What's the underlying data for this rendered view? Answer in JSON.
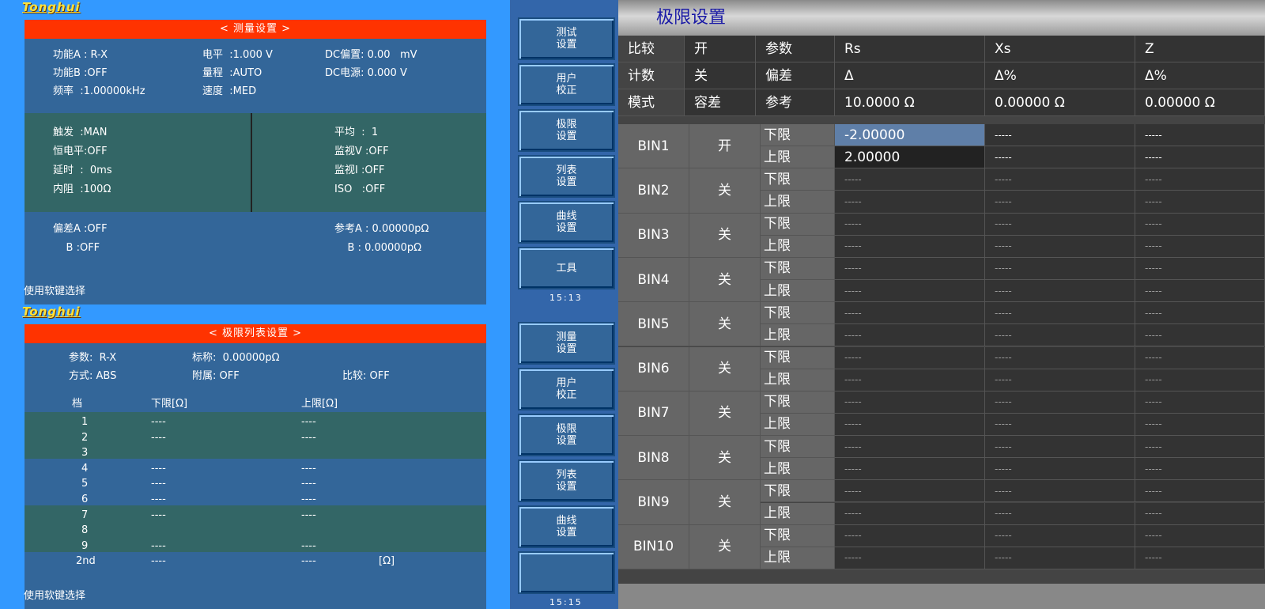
{
  "top": {
    "logo": "Tonghui",
    "title": "< 测量设置 >",
    "hint": "使用软键选择",
    "time": "15:13",
    "rows": [
      [
        "功能A : R-X",
        "电平  :1.000 V",
        "DC偏置: 0.00   mV"
      ],
      [
        "功能B :OFF",
        "量程  :AUTO",
        "DC电源: 0.000 V"
      ],
      [
        "频率  :1.00000kHz",
        "速度  :MED",
        ""
      ]
    ],
    "left": [
      "触发  :MAN",
      "恒电平:OFF",
      "延时  :  0ms",
      "内阻  :100Ω"
    ],
    "right": [
      "平均  :  1",
      "监视V :OFF",
      "监视I :OFF",
      "ISO   :OFF"
    ],
    "dev": [
      "偏差A :OFF",
      "    B :OFF"
    ],
    "ref": [
      "参考A : 0.00000pΩ",
      "    B : 0.00000pΩ"
    ],
    "softkeys": [
      "测试\n设置",
      "用户\n校正",
      "极限\n设置",
      "列表\n设置",
      "曲线\n设置",
      "工具"
    ]
  },
  "bot": {
    "logo": "Tonghui",
    "title": "< 极限列表设置 >",
    "hint": "使用软键选择",
    "time": "15:15",
    "hdr": [
      "参数:  R-X",
      "标称:  0.00000pΩ",
      "方式: ABS",
      "附属: OFF",
      "比较: OFF"
    ],
    "cols": [
      "档",
      "下限[Ω]",
      "上限[Ω]"
    ],
    "rows": [
      [
        "1",
        "----",
        "----"
      ],
      [
        "2",
        "----",
        "----"
      ],
      [
        "3",
        "",
        ""
      ],
      [
        "4",
        "----",
        "----"
      ],
      [
        "5",
        "----",
        "----"
      ],
      [
        "6",
        "----",
        "----"
      ],
      [
        "7",
        "----",
        "----"
      ],
      [
        "8",
        "",
        ""
      ],
      [
        "9",
        "----",
        "----"
      ],
      [
        "2nd",
        "----",
        "----"
      ]
    ],
    "unit": "[Ω]",
    "softkeys": [
      "测量\n设置",
      "用户\n校正",
      "极限\n设置",
      "列表\n设置",
      "曲线\n设置",
      ""
    ]
  },
  "right": {
    "title": "极限设置",
    "cfg": [
      [
        "比较",
        "开"
      ],
      [
        "计数",
        "关"
      ],
      [
        "模式",
        "容差"
      ]
    ],
    "params": [
      [
        "参数",
        "Rs",
        "Xs",
        "Z"
      ],
      [
        "偏差",
        "Δ",
        "Δ%",
        "Δ%"
      ],
      [
        "参考",
        "10.0000 Ω",
        "0.00000 Ω",
        "0.00000 Ω"
      ]
    ],
    "lo": "下限",
    "hi": "上限",
    "bins": [
      [
        "BIN1",
        "开",
        "-2.00000",
        "2.00000"
      ],
      [
        "BIN2",
        "关",
        "-----",
        "-----"
      ],
      [
        "BIN3",
        "关",
        "-----",
        "-----"
      ],
      [
        "BIN4",
        "关",
        "-----",
        "-----"
      ],
      [
        "BIN5",
        "关",
        "-----",
        "-----"
      ],
      [
        "BIN6",
        "关",
        "-----",
        "-----"
      ],
      [
        "BIN7",
        "关",
        "-----",
        "-----"
      ],
      [
        "BIN8",
        "关",
        "-----",
        "-----"
      ],
      [
        "BIN9",
        "关",
        "-----",
        "-----"
      ],
      [
        "BIN10",
        "关",
        "-----",
        "-----"
      ]
    ],
    "dash": "-----"
  }
}
